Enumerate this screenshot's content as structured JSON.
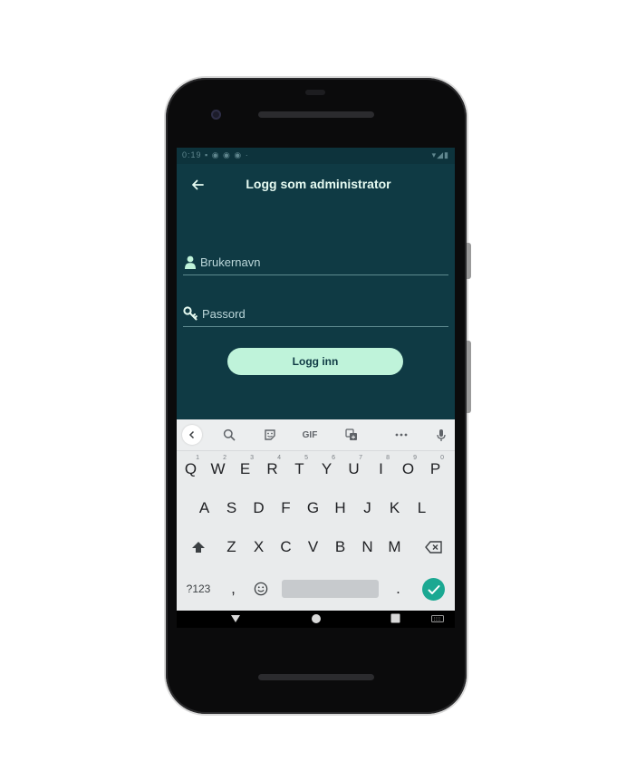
{
  "status_bar": {
    "left": "0:19 ▪ ◉ ◉ ◉ ·",
    "right": "▾◢▮"
  },
  "app_bar": {
    "title": "Logg  som administrator",
    "back_icon": "arrow-left-icon"
  },
  "form": {
    "username_placeholder": "Brukernavn",
    "password_placeholder": "Passord",
    "login_label": "Logg inn"
  },
  "keyboard": {
    "toolbar": {
      "gif_label": "GIF"
    },
    "rows": [
      [
        {
          "label": "Q",
          "hint": "1"
        },
        {
          "label": "W",
          "hint": "2"
        },
        {
          "label": "E",
          "hint": "3"
        },
        {
          "label": "R",
          "hint": "4"
        },
        {
          "label": "T",
          "hint": "5"
        },
        {
          "label": "Y",
          "hint": "6"
        },
        {
          "label": "U",
          "hint": "7"
        },
        {
          "label": "I",
          "hint": "8"
        },
        {
          "label": "O",
          "hint": "9"
        },
        {
          "label": "P",
          "hint": "0"
        }
      ],
      [
        {
          "label": "A"
        },
        {
          "label": "S"
        },
        {
          "label": "D"
        },
        {
          "label": "F"
        },
        {
          "label": "G"
        },
        {
          "label": "H"
        },
        {
          "label": "J"
        },
        {
          "label": "K"
        },
        {
          "label": "L"
        }
      ],
      [
        {
          "label": "Z"
        },
        {
          "label": "X"
        },
        {
          "label": "C"
        },
        {
          "label": "V"
        },
        {
          "label": "B"
        },
        {
          "label": "N"
        },
        {
          "label": "M"
        }
      ]
    ],
    "symbols_label": "?123",
    "comma_label": ",",
    "period_label": "."
  },
  "colors": {
    "screen_bg": "#0f3a44",
    "accent": "#bff3da",
    "enter_key": "#1ba892",
    "keyboard_bg": "#e9ebec"
  }
}
